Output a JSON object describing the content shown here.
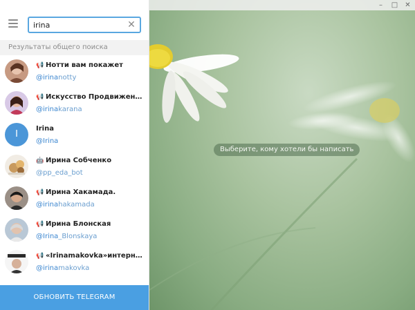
{
  "search": {
    "value": "irina",
    "clear_icon": "close-icon"
  },
  "section_label": "Результаты общего поиска",
  "results": [
    {
      "title": "Нотти вам покажет",
      "handle_hl": "@irina",
      "handle_rest": "notty",
      "type_icon": "megaphone-icon",
      "avatar": "photo"
    },
    {
      "title": "Искусство Продвижения I...",
      "handle_hl": "@irina",
      "handle_rest": "karana",
      "type_icon": "megaphone-icon",
      "avatar": "photo"
    },
    {
      "title": "Irina",
      "handle_hl": "@Irina",
      "handle_rest": "",
      "type_icon": "",
      "avatar_letter": "I"
    },
    {
      "title": "Ирина Собченко",
      "handle_hl": "",
      "handle_rest": "@pp_eda_bot",
      "type_icon": "bot-icon",
      "avatar": "photo"
    },
    {
      "title": "Ирина Хакамада.",
      "handle_hl": "@irina",
      "handle_rest": "hakamada",
      "type_icon": "megaphone-icon",
      "avatar": "photo"
    },
    {
      "title": "Ирина Блонская",
      "handle_hl": "@Irina",
      "handle_rest": "_Blonskaya",
      "type_icon": "megaphone-icon",
      "avatar": "photo"
    },
    {
      "title": "«Irinamakovka»интернет-...",
      "handle_hl": "@irina",
      "handle_rest": "makovka",
      "type_icon": "megaphone-icon",
      "avatar": "photo"
    }
  ],
  "update_button": "ОБНОВИТЬ TELEGRAM",
  "empty_chat_message": "Выберите, кому хотели бы написать",
  "window_controls": {
    "minimize": "–",
    "maximize": "□",
    "close": "✕"
  },
  "colors": {
    "accent": "#4a9fe2",
    "link": "#3b86d0",
    "letter_avatar": "#4b96d8"
  }
}
